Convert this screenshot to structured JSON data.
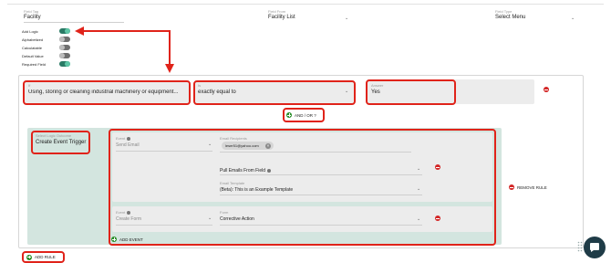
{
  "top_fields": {
    "field_tag": {
      "label": "Field Tag",
      "value": "Facility"
    },
    "field_from": {
      "label": "Field From",
      "value": "Facility List"
    },
    "field_type": {
      "label": "Field Type",
      "value": "Select Menu"
    }
  },
  "options": [
    {
      "label": "Add Logic",
      "on": true
    },
    {
      "label": "Alphabetized",
      "on": false
    },
    {
      "label": "Calculatable",
      "on": false
    },
    {
      "label": "Default Value",
      "on": false
    },
    {
      "label": "Required Field",
      "on": true
    }
  ],
  "rule": {
    "if_label": "If",
    "if_value": "Using, storing or cleaning industrial machinery or equipment...",
    "is_label": "Is",
    "is_value": "exactly equal to",
    "answer_label": "Answer",
    "answer_value": "Yes",
    "and_or_label": "AND / OR ?",
    "remove_rule_label": "REMOVE RULE"
  },
  "logic": {
    "action_label": "Select Logic Outcome",
    "action_value": "Create Event Trigger"
  },
  "events": [
    {
      "event_label": "Event",
      "event_value": "Send Email",
      "recipients_label": "Email Recipients",
      "recipient_chip": "leser51@yahoo.com",
      "pull_emails_label": "Pull Emails From Field",
      "template_label": "Email Template",
      "template_value": "(Beta): This is an Example Template"
    },
    {
      "event_label": "Event",
      "event_value": "Create Form",
      "form_label": "Form",
      "form_value": "Corrective Action"
    }
  ],
  "add_event_label": "ADD EVENT",
  "add_rule_label": "ADD RULE",
  "colors": {
    "annotation_red": "#e0231a",
    "toggle_on": "#2a7a65",
    "logic_panel": "#d3e5df",
    "event_box": "#ececec",
    "add_green": "#2a8f2a",
    "remove_red": "#d32626",
    "chat_button": "#1f3c47"
  },
  "icons": [
    "info-icon",
    "chevron-down-icon",
    "chip-remove-icon",
    "minus-circle-icon",
    "plus-circle-icon",
    "chat-icon",
    "grip-dots-icon"
  ]
}
